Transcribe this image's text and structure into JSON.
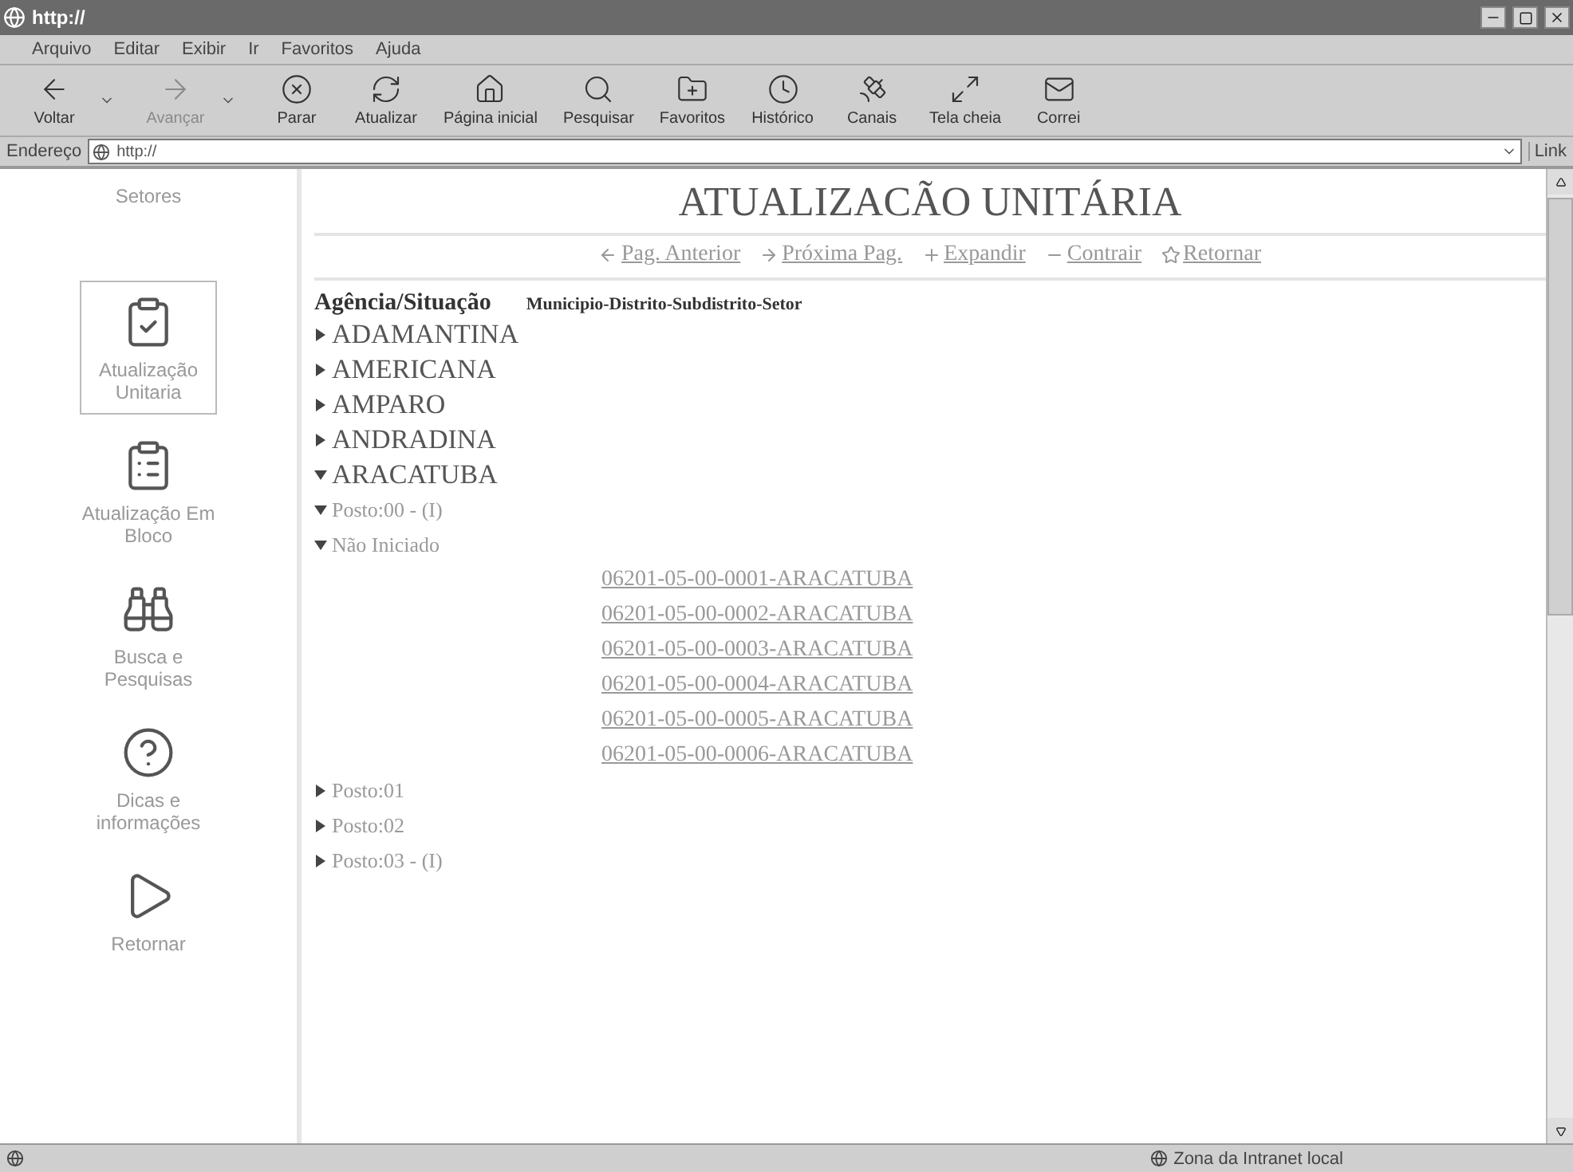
{
  "window": {
    "title": "http://"
  },
  "menu": [
    {
      "label": "Arquivo"
    },
    {
      "label": "Editar"
    },
    {
      "label": "Exibir"
    },
    {
      "label": "Ir"
    },
    {
      "label": "Favoritos"
    },
    {
      "label": "Ajuda"
    }
  ],
  "toolbar": [
    {
      "label": "Voltar",
      "disabled": false,
      "dropdown": true
    },
    {
      "label": "Avançar",
      "disabled": true,
      "dropdown": true
    },
    {
      "label": "Parar",
      "disabled": false,
      "dropdown": false
    },
    {
      "label": "Atualizar",
      "disabled": false,
      "dropdown": false
    },
    {
      "label": "Página inicial",
      "disabled": false,
      "dropdown": false
    },
    {
      "label": "Pesquisar",
      "disabled": false,
      "dropdown": false
    },
    {
      "label": "Favoritos",
      "disabled": false,
      "dropdown": false
    },
    {
      "label": "Histórico",
      "disabled": false,
      "dropdown": false
    },
    {
      "label": "Canais",
      "disabled": false,
      "dropdown": false
    },
    {
      "label": "Tela cheia",
      "disabled": false,
      "dropdown": false
    },
    {
      "label": "Correi",
      "disabled": false,
      "dropdown": false
    }
  ],
  "address": {
    "label": "Endereço",
    "value": "http://",
    "links": "Link"
  },
  "sidebar": {
    "title": "Setores",
    "items": [
      {
        "label": "Atualização Unitaria",
        "selected": true
      },
      {
        "label": "Atualização Em Bloco",
        "selected": false
      },
      {
        "label": "Busca e Pesquisas",
        "selected": false
      },
      {
        "label": "Dicas e informações",
        "selected": false
      },
      {
        "label": "Retornar",
        "selected": false
      }
    ]
  },
  "page": {
    "title": "ATUALIZACÃO UNITÁRIA",
    "nav": [
      {
        "label": "Pag. Anterior"
      },
      {
        "label": "Próxima Pag."
      },
      {
        "label": "Expandir"
      },
      {
        "label": "Contrair"
      },
      {
        "label": "Retornar"
      }
    ],
    "columns": [
      "Agência/Situação",
      "Municipio-Distrito-Subdistrito-Setor"
    ],
    "tree": [
      {
        "label": "ADAMANTINA",
        "kind": "agency",
        "expanded": false
      },
      {
        "label": "AMERICANA",
        "kind": "agency",
        "expanded": false
      },
      {
        "label": "AMPARO",
        "kind": "agency",
        "expanded": false
      },
      {
        "label": "ANDRADINA",
        "kind": "agency",
        "expanded": false
      },
      {
        "label": "ARACATUBA",
        "kind": "agency",
        "expanded": true,
        "children": [
          {
            "label": "Posto:00 - (I)",
            "kind": "posto",
            "expanded": true,
            "children": [
              {
                "label": "Não Iniciado",
                "kind": "status",
                "expanded": true,
                "children": [
                  {
                    "label": "06201-05-00-0001-ARACATUBA",
                    "kind": "sector"
                  },
                  {
                    "label": "06201-05-00-0002-ARACATUBA",
                    "kind": "sector"
                  },
                  {
                    "label": "06201-05-00-0003-ARACATUBA",
                    "kind": "sector"
                  },
                  {
                    "label": "06201-05-00-0004-ARACATUBA",
                    "kind": "sector"
                  },
                  {
                    "label": "06201-05-00-0005-ARACATUBA",
                    "kind": "sector"
                  },
                  {
                    "label": "06201-05-00-0006-ARACATUBA",
                    "kind": "sector"
                  }
                ]
              }
            ]
          },
          {
            "label": "Posto:01",
            "kind": "posto",
            "expanded": false
          },
          {
            "label": "Posto:02",
            "kind": "posto",
            "expanded": false
          },
          {
            "label": "Posto:03 - (I)",
            "kind": "posto",
            "expanded": false
          }
        ]
      }
    ]
  },
  "status_bar": {
    "zone": "Zona da Intranet local"
  }
}
